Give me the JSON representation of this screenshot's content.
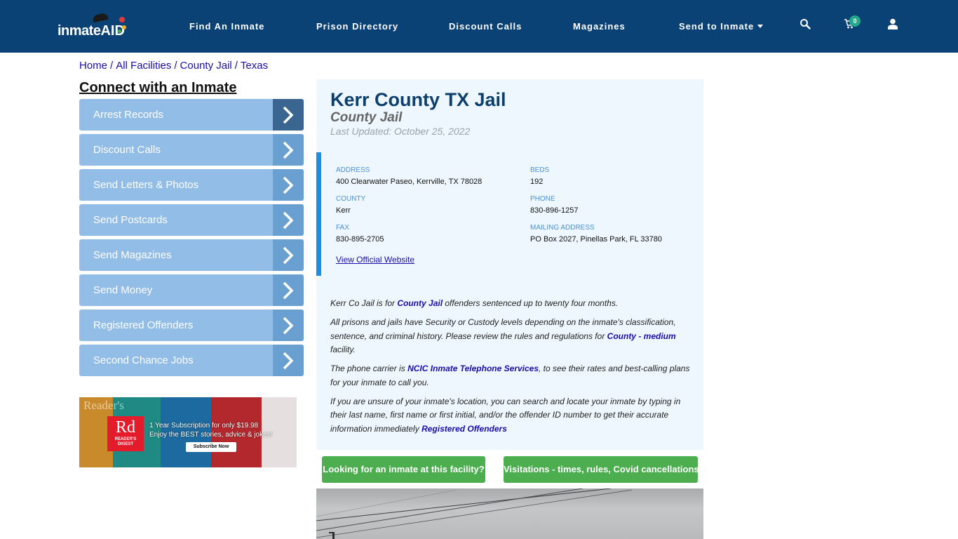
{
  "header": {
    "logo_text": "inmate",
    "logo_accent": "AID",
    "nav": [
      {
        "label": "Find An Inmate"
      },
      {
        "label": "Prison Directory"
      },
      {
        "label": "Discount Calls"
      },
      {
        "label": "Magazines"
      },
      {
        "label": "Send to Inmate",
        "has_dropdown": true
      }
    ],
    "icons": [
      "search-icon",
      "cart-icon",
      "user-icon"
    ],
    "cart_count": "0",
    "colors": {
      "bar": "#0b4275",
      "badge": "#20a98a"
    }
  },
  "breadcrumb": [
    {
      "label": "Home"
    },
    {
      "label": "All Facilities"
    },
    {
      "label": "County Jail"
    },
    {
      "label": "Texas"
    }
  ],
  "breadcrumb_separator": "/",
  "sidebar": {
    "title": "Connect with an Inmate",
    "items": [
      {
        "label": "Arrest Records",
        "active": true
      },
      {
        "label": "Discount Calls"
      },
      {
        "label": "Send Letters & Photos"
      },
      {
        "label": "Send Postcards"
      },
      {
        "label": "Send Magazines"
      },
      {
        "label": "Send Money"
      },
      {
        "label": "Registered Offenders"
      },
      {
        "label": "Second Chance Jobs"
      }
    ]
  },
  "ad": {
    "brand_mark": "Rd",
    "brand_name": "READER'S DIGEST",
    "masthead": "Reader's",
    "line1": "1 Year Subscription for only $19.98",
    "line2": "Enjoy the BEST stories, advice & jokes!",
    "cta": "Subscribe Now"
  },
  "facility": {
    "title": "Kerr County TX Jail",
    "type": "County Jail",
    "last_updated": "Last Updated: October 25, 2022",
    "fields": {
      "address": {
        "label": "ADDRESS",
        "value": "400 Clearwater Paseo, Kerrville, TX 78028"
      },
      "beds": {
        "label": "BEDS",
        "value": "192"
      },
      "county": {
        "label": "COUNTY",
        "value": "Kerr"
      },
      "phone": {
        "label": "PHONE",
        "value": "830-896-1257"
      },
      "fax": {
        "label": "FAX",
        "value": "830-895-2705"
      },
      "mailing": {
        "label": "MAILING ADDRESS",
        "value": "PO Box 2027, Pinellas Park, FL 33780"
      }
    },
    "website_link": "View Official Website"
  },
  "description": {
    "p1_a": "Kerr Co Jail is for ",
    "p1_link": "County Jail",
    "p1_b": " offenders sentenced up to twenty four months.",
    "p2_a": "All prisons and jails have Security or Custody levels depending on the inmate's classification, sentence, and criminal history. Please review the rules and regulations for ",
    "p2_link": "County - medium",
    "p2_b": " facility.",
    "p3_a": "The phone carrier is ",
    "p3_link": "NCIC Inmate Telephone Services",
    "p3_b": ", to see their rates and best-calling plans for your inmate to call you.",
    "p4_a": "If you are unsure of your inmate's location, you can search and locate your inmate by typing in their last name, first name or first initial, and/or the offender ID number to get their accurate information immediately ",
    "p4_link": "Registered Offenders"
  },
  "actions": {
    "find_inmate": "Looking for an inmate at this facility?",
    "visitations": "Visitations - times, rules, Covid cancellations"
  },
  "photo": {
    "description": "facility-photo-overcast-sky"
  }
}
